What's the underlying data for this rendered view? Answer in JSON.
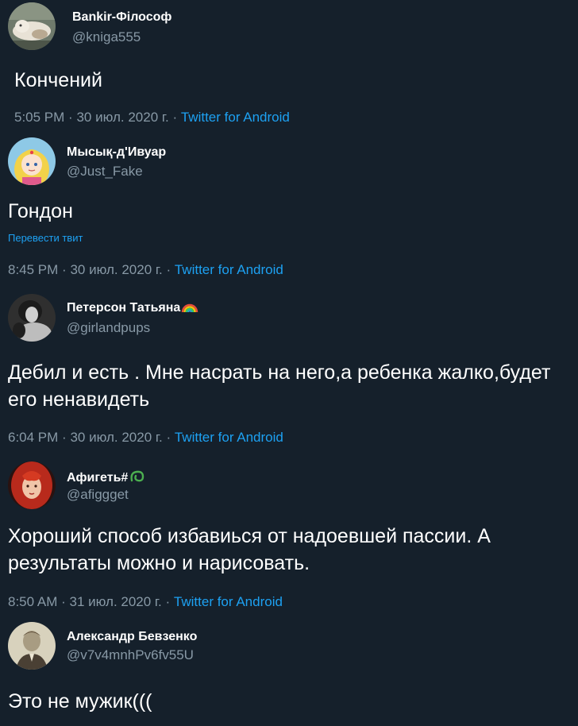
{
  "tweets": [
    {
      "name": "Bankir-Філософ",
      "handle": "@kniga555",
      "text": "Кончений",
      "time": "5:05 PM",
      "date": "30 июл. 2020 г.",
      "source": "Twitter for Android",
      "separator": "·"
    },
    {
      "name": "Мысық-д'Ивуар",
      "handle": "@Just_Fake",
      "text": "Гондон",
      "translate": "Перевести твит",
      "time": "8:45 PM",
      "date": "30 июл. 2020 г.",
      "source": "Twitter for Android",
      "separator": "·"
    },
    {
      "name": "Петерсон Татьяна",
      "handle": "@girlandpups",
      "text": "Дебил и есть . Мне насрать на него,а ребенка жалко,будет его ненавидеть",
      "time": "6:04 PM",
      "date": "30 июл. 2020 г.",
      "source": "Twitter for Android",
      "separator": "·",
      "emoji": "rainbow-icon"
    },
    {
      "name": "Афигеть#",
      "handle": "@afiggget",
      "text": "Хороший способ избавиься от надоевшей пассии. А результаты можно и нарисовать.",
      "time": "8:50 AM",
      "date": "31 июл. 2020 г.",
      "source": "Twitter for Android",
      "separator": "·",
      "emoji": "green-loop-icon"
    },
    {
      "name": "Александр Бевзенко",
      "handle": "@v7v4mnhPv6fv55U",
      "text": "Это не мужик((("
    }
  ],
  "colors": {
    "background": "#15202b",
    "text": "#ffffff",
    "secondary": "#8899a6",
    "link": "#1da1f2"
  }
}
